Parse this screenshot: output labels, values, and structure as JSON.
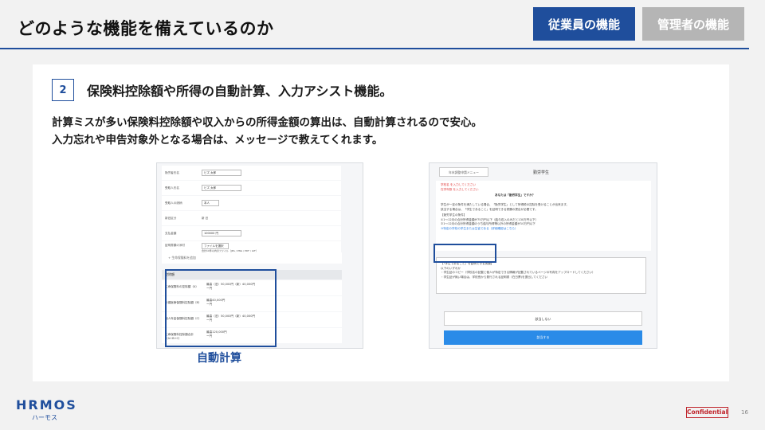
{
  "header": {
    "title": "どのような機能を備えているのか",
    "tabs": [
      {
        "label": "従業員の機能",
        "active": true
      },
      {
        "label": "管理者の機能",
        "active": false
      }
    ],
    "accent_color": "#1f4e9c"
  },
  "section": {
    "number": "2",
    "heading": "保険料控除額や所得の自動計算、入力アシスト機能。",
    "body_lines": [
      "計算ミスが多い保険料控除額や収入からの所得金額の算出は、自動計算されるので安心。",
      "入力忘れや申告対象外となる場合は、メッセージで教えてくれます。"
    ]
  },
  "left_screenshot": {
    "caption": "自動計算",
    "form_rows": [
      {
        "label": "勤労者氏名",
        "value": "ビズ 太郎"
      },
      {
        "label": "受取人氏名",
        "value": "ビズ 太郎"
      },
      {
        "label": "受取人の続柄",
        "value": "本人"
      },
      {
        "label": "新旧区分",
        "value": "新  旧"
      },
      {
        "label": "支払金額",
        "value": "100000 円"
      },
      {
        "label": "証明書類の添付",
        "value": "ファイルを選択"
      }
    ],
    "file_note": "合計10件以内のファイル（JPG / PNG / PDF / GIF）",
    "add_link": "+ 生命保険料を追加",
    "section_label": "控除額",
    "calc_rows": [
      {
        "label": "生命保険料の控除額（A）",
        "value": "最高（旧）50,000円（新）40,000円",
        "sub": "ー円"
      },
      {
        "label": "介護医療保険料控除額（B）",
        "value": "最高40,000円",
        "sub": "ー円"
      },
      {
        "label": "個人年金保険料控除額（C）",
        "value": "最高（旧）50,000円（新）40,000円",
        "sub": "ー円"
      },
      {
        "label": "生命保険料控除額合計（A+B+C）",
        "value": "最高120,000円",
        "sub": "ー円"
      }
    ]
  },
  "right_screenshot": {
    "tab_label": "年末調整申請メニュー",
    "title": "勤労学生",
    "alert_lines": [
      "学校名 を入力してください",
      "在学年数 を入力してください"
    ],
    "question": "あなたは「勤労学生」ですか？",
    "description_lines": [
      "学生が一定の条件を満たしている場合、「勤労学生」として所得税の控除を受けることが出来ます。",
      "該当する場合は、「学生であること」を証明できる書類の提出が必要です。",
      "【勤労学生の条件】",
      "①1〜12月の合計所得金額が75万円以下（給与収入のみだと130万円以下）",
      "②1〜12月の合計所得金額のうち給与所得等以外の所得金額が10万円以下",
      "③特定の学校の学生または生徒である（詳細確認はこちら）"
    ],
    "box_lines": [
      "【「学生であること」を証明できる書類】",
      "以下のいずれか",
      "・学生証のコピー（学校名の記載と個人が特定できる情報が記載されているページの写真をアップロードしてください）",
      "・学生証が無い場合は、学校長から発行される証明書（在日票)を提出してください"
    ],
    "button_secondary": "該当しない",
    "button_primary": "該当する"
  },
  "footer": {
    "logo": "HRMOS",
    "logo_sub": "ハーモス",
    "confidential": "Confidential",
    "page_number": "16"
  }
}
